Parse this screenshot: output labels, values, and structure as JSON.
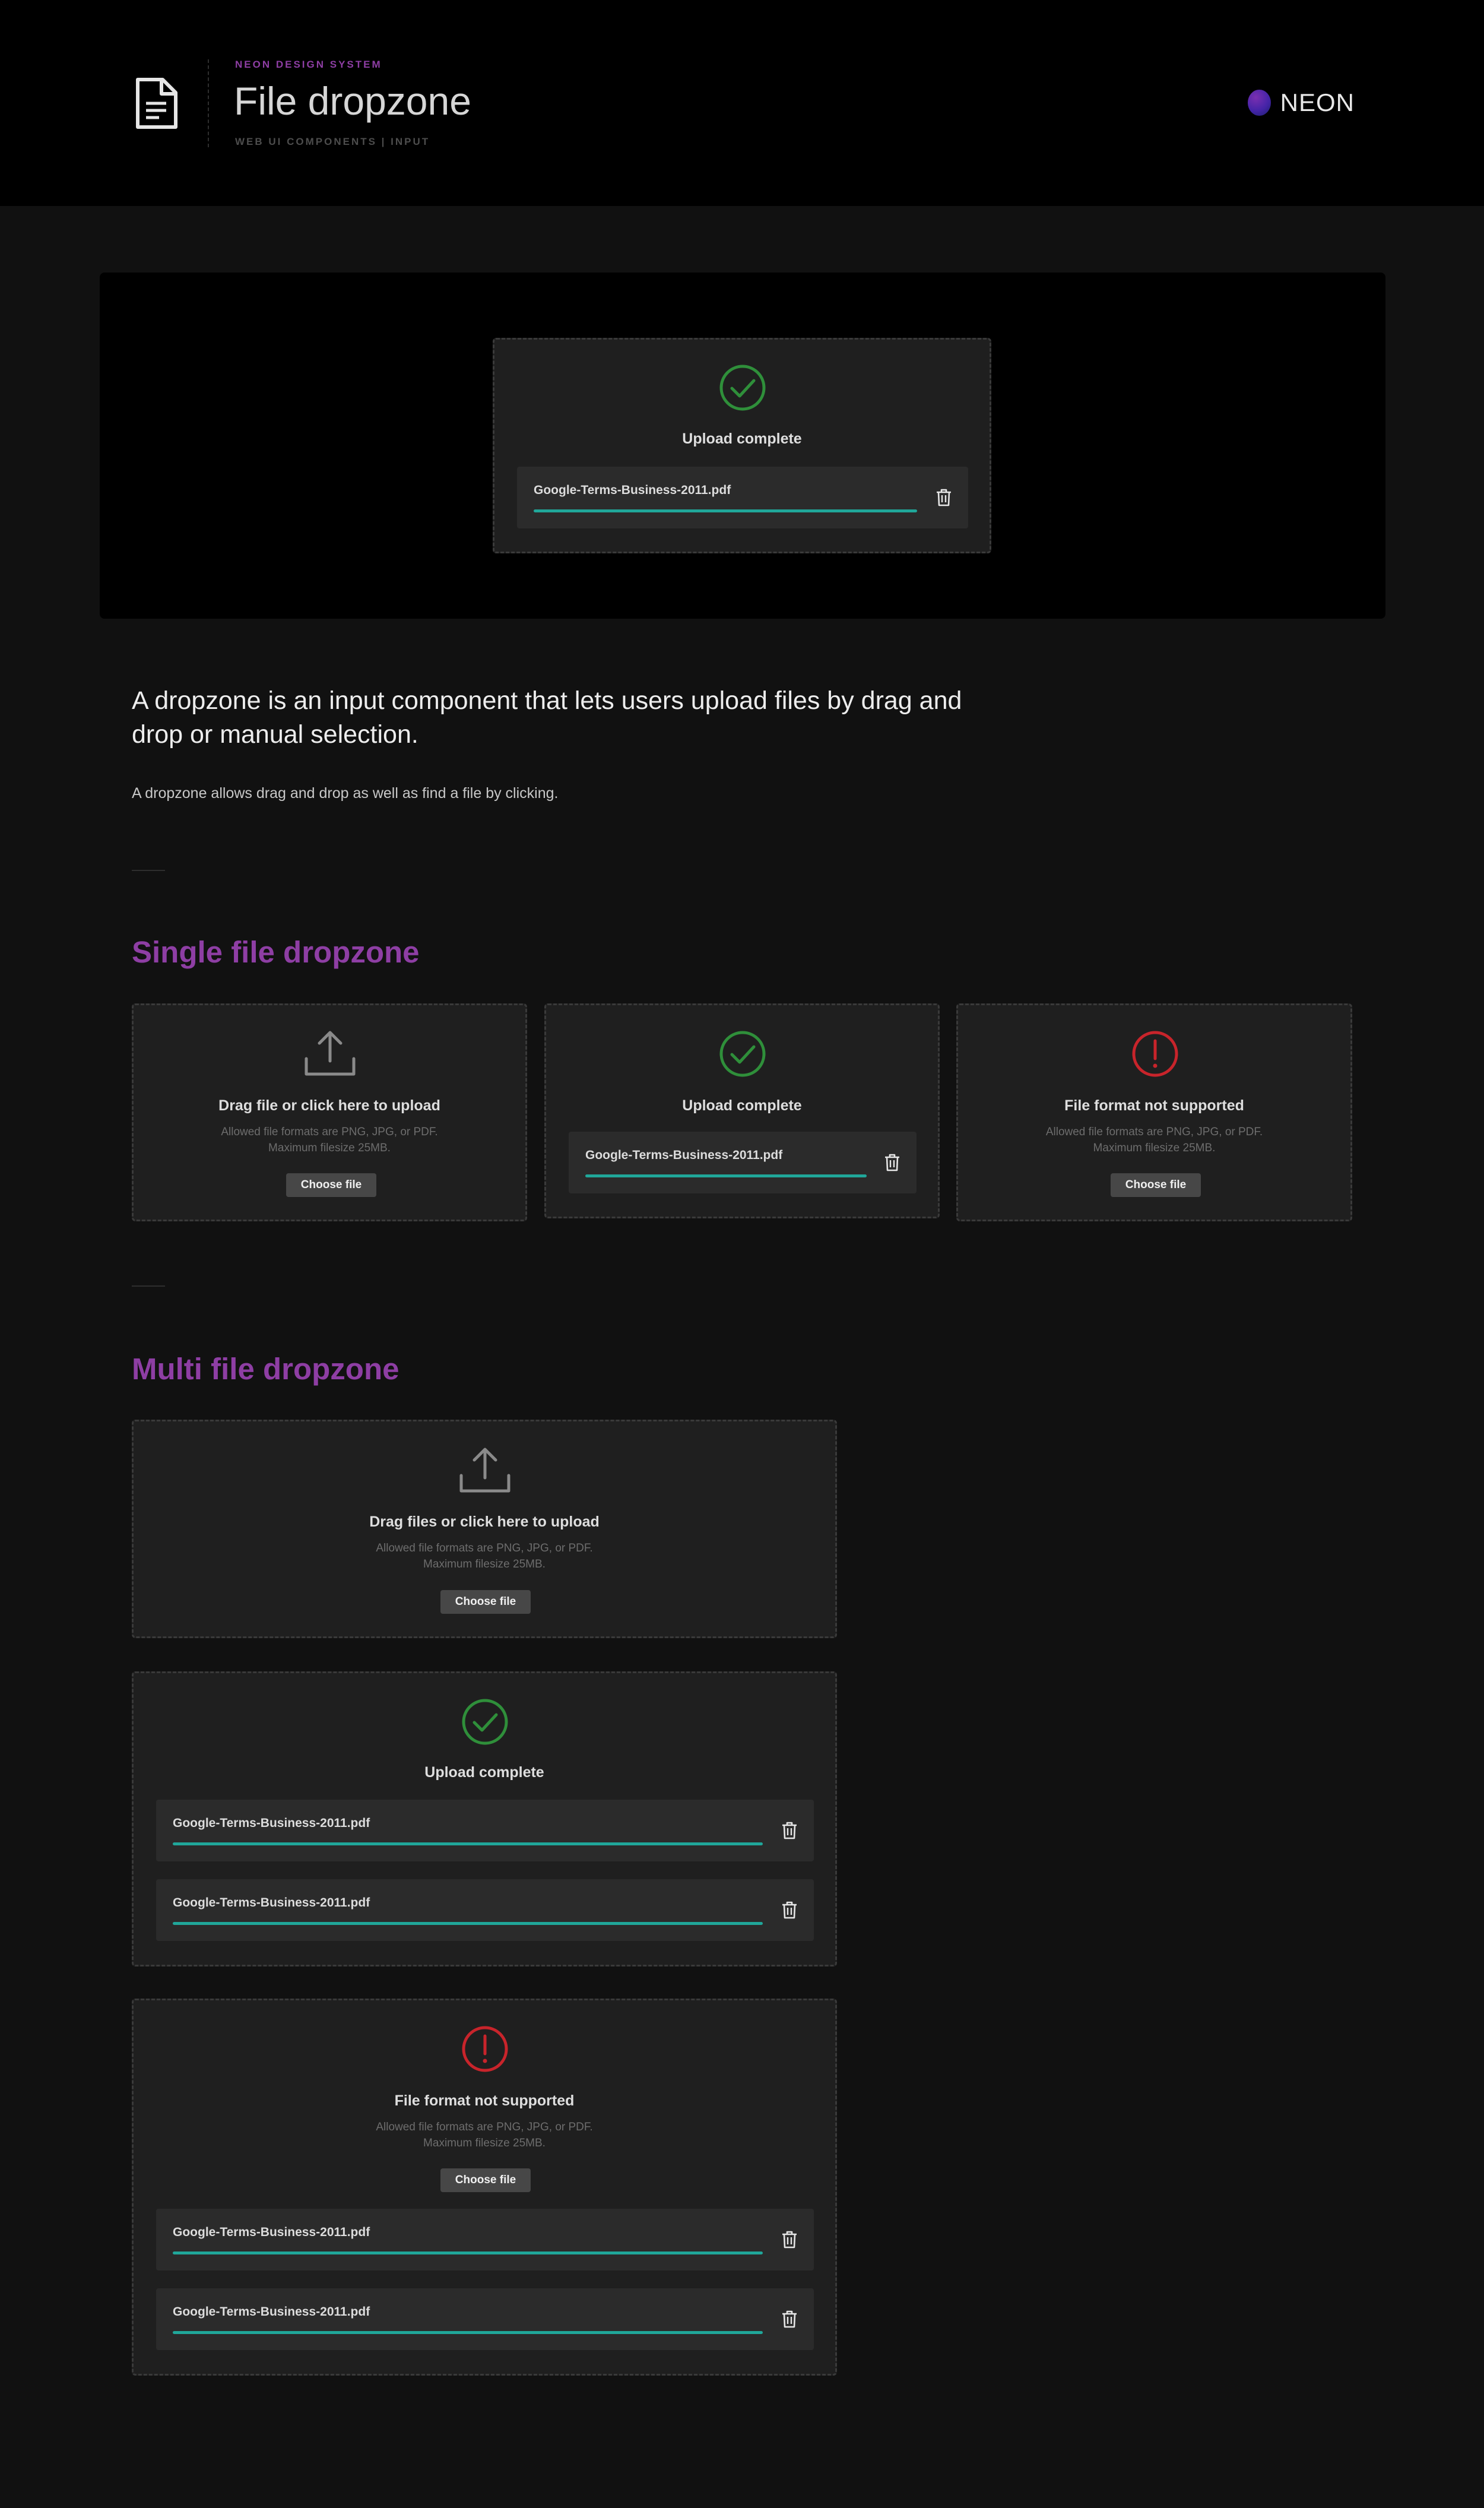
{
  "header": {
    "eyebrow": "NEON DESIGN SYSTEM",
    "title": "File dropzone",
    "subtitle": "WEB UI COMPONENTS | INPUT",
    "logo_text": "NEON"
  },
  "intro": {
    "lead": "A dropzone is an input component that lets users upload files by drag and drop or manual selection.",
    "small": "A dropzone allows drag and drop as well as find a file by clicking."
  },
  "sections": {
    "single": "Single file dropzone",
    "multi": "Multi file dropzone"
  },
  "dropzone": {
    "upload_title_single": "Drag file or click here to upload",
    "upload_title_multi": "Drag files or click here to upload",
    "complete_title": "Upload complete",
    "error_title": "File format not supported",
    "hint_line1": "Allowed file formats are PNG, JPG, or PDF.",
    "hint_line2": "Maximum filesize 25MB.",
    "choose_label": "Choose file",
    "file_name": "Google-Terms-Business-2011.pdf",
    "progress": 1.0
  },
  "colors": {
    "accent": "#8e3ea4",
    "success": "#2f8f3a",
    "error": "#c8242b",
    "progress": "#20a79a"
  },
  "icons": [
    "document-icon",
    "upload-icon",
    "check-circle-icon",
    "alert-circle-icon",
    "trash-icon"
  ]
}
